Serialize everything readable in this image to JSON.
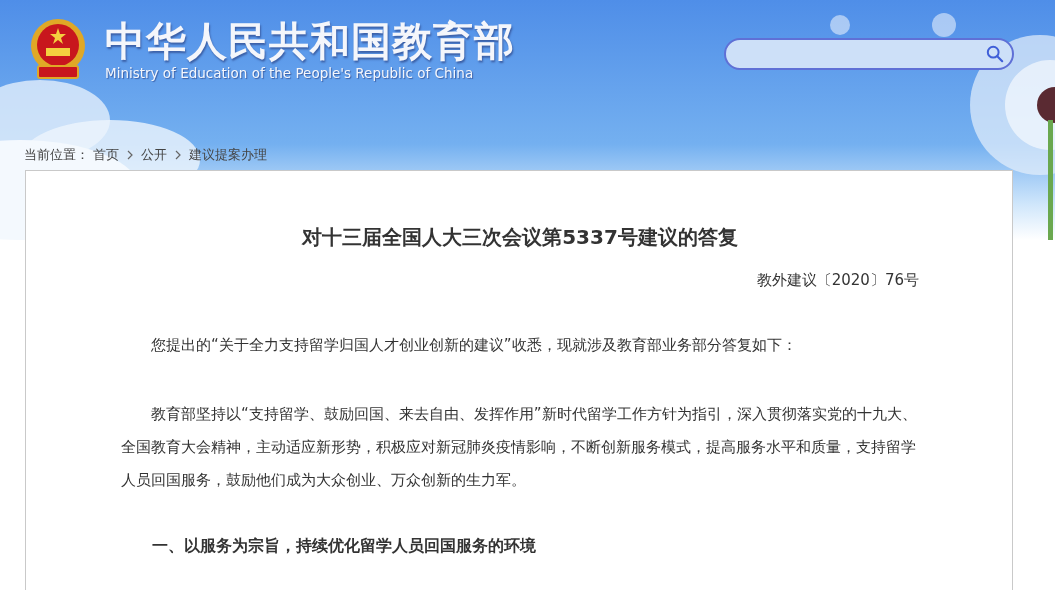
{
  "header": {
    "title": "中华人民共和国教育部",
    "subtitle": "Ministry of Education of the People's Republic of China"
  },
  "breadcrumb": {
    "label": "当前位置：",
    "items": [
      "首页",
      "公开",
      "建议提案办理"
    ]
  },
  "article": {
    "title": "对十三届全国人大三次会议第5337号建议的答复",
    "doc_number": "教外建议〔2020〕76号",
    "blocks": [
      {
        "kind": "paragraph",
        "text": "您提出的“关于全力支持留学归国人才创业创新的建议”收悉，现就涉及教育部业务部分答复如下："
      },
      {
        "kind": "paragraph",
        "text": "教育部坚持以“支持留学、鼓励回国、来去自由、发挥作用”新时代留学工作方针为指引，深入贯彻落实党的十九大、全国教育大会精神，主动适应新形势，积极应对新冠肺炎疫情影响，不断创新服务模式，提高服务水平和质量，支持留学人员回国服务，鼓励他们成为大众创业、万众创新的生力军。"
      },
      {
        "kind": "heading",
        "text": "一、以服务为宗旨，持续优化留学人员回国服务的环境"
      }
    ]
  }
}
